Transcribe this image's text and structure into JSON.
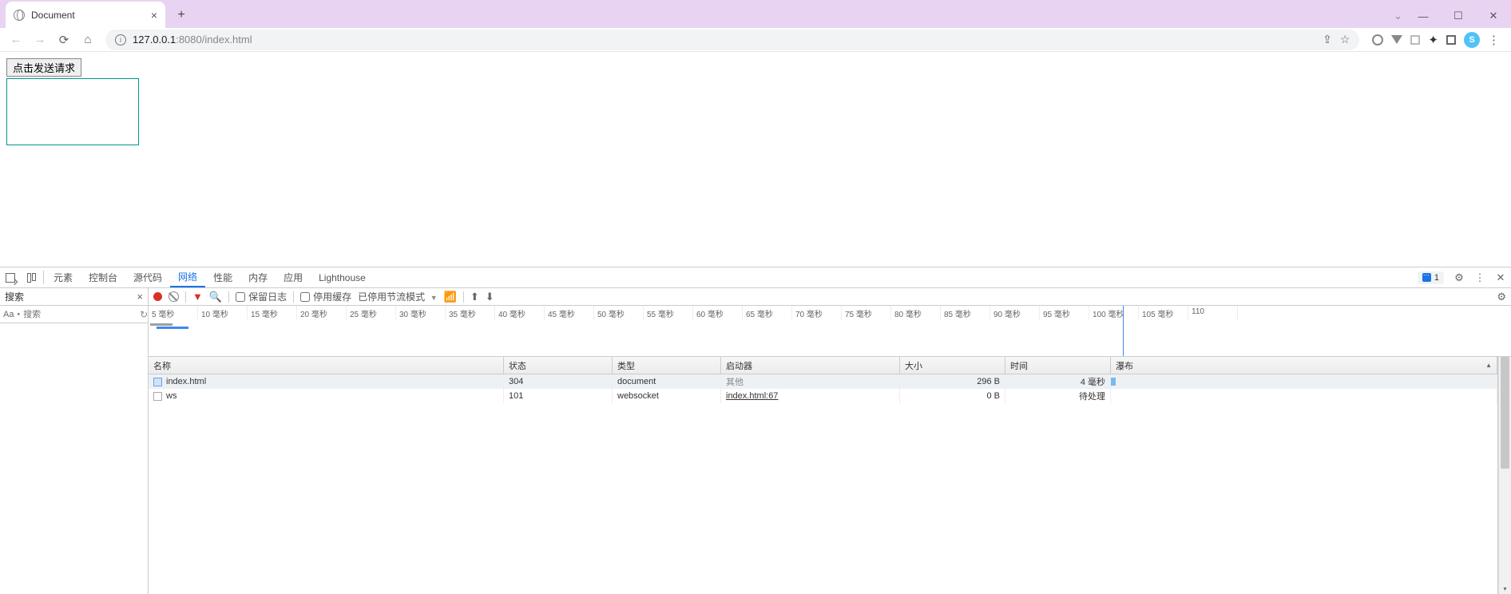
{
  "browser": {
    "tab_title": "Document",
    "url_host": "127.0.0.1",
    "url_port_path": ":8080/index.html"
  },
  "page": {
    "button_label": "点击发送请求"
  },
  "devtools": {
    "tabs": {
      "elements": "元素",
      "console": "控制台",
      "sources": "源代码",
      "network": "网络",
      "performance": "性能",
      "memory": "内存",
      "application": "应用",
      "lighthouse": "Lighthouse"
    },
    "issues_count": "1",
    "search": {
      "title": "搜索",
      "placeholder": "搜索",
      "aa": "Aa"
    },
    "net_toolbar": {
      "preserve_log": "保留日志",
      "disable_cache": "停用缓存",
      "throttling": "已停用节流模式"
    },
    "timeline_ticks": [
      "5 毫秒",
      "10 毫秒",
      "15 毫秒",
      "20 毫秒",
      "25 毫秒",
      "30 毫秒",
      "35 毫秒",
      "40 毫秒",
      "45 毫秒",
      "50 毫秒",
      "55 毫秒",
      "60 毫秒",
      "65 毫秒",
      "70 毫秒",
      "75 毫秒",
      "80 毫秒",
      "85 毫秒",
      "90 毫秒",
      "95 毫秒",
      "100 毫秒",
      "105 毫秒",
      "110"
    ],
    "columns": {
      "name": "名称",
      "status": "状态",
      "type": "类型",
      "initiator": "启动器",
      "size": "大小",
      "time": "时间",
      "waterfall": "瀑布"
    },
    "rows": [
      {
        "name": "index.html",
        "status": "304",
        "type": "document",
        "initiator": "其他",
        "initiator_gray": true,
        "size": "296 B",
        "time": "4 毫秒",
        "wf_left": 0,
        "wf_width": 6,
        "icon": "doc"
      },
      {
        "name": "ws",
        "status": "101",
        "type": "websocket",
        "initiator": "index.html:67",
        "initiator_gray": false,
        "size": "0 B",
        "time": "待处理",
        "wf_left": 0,
        "wf_width": 0,
        "icon": "ws"
      }
    ]
  }
}
